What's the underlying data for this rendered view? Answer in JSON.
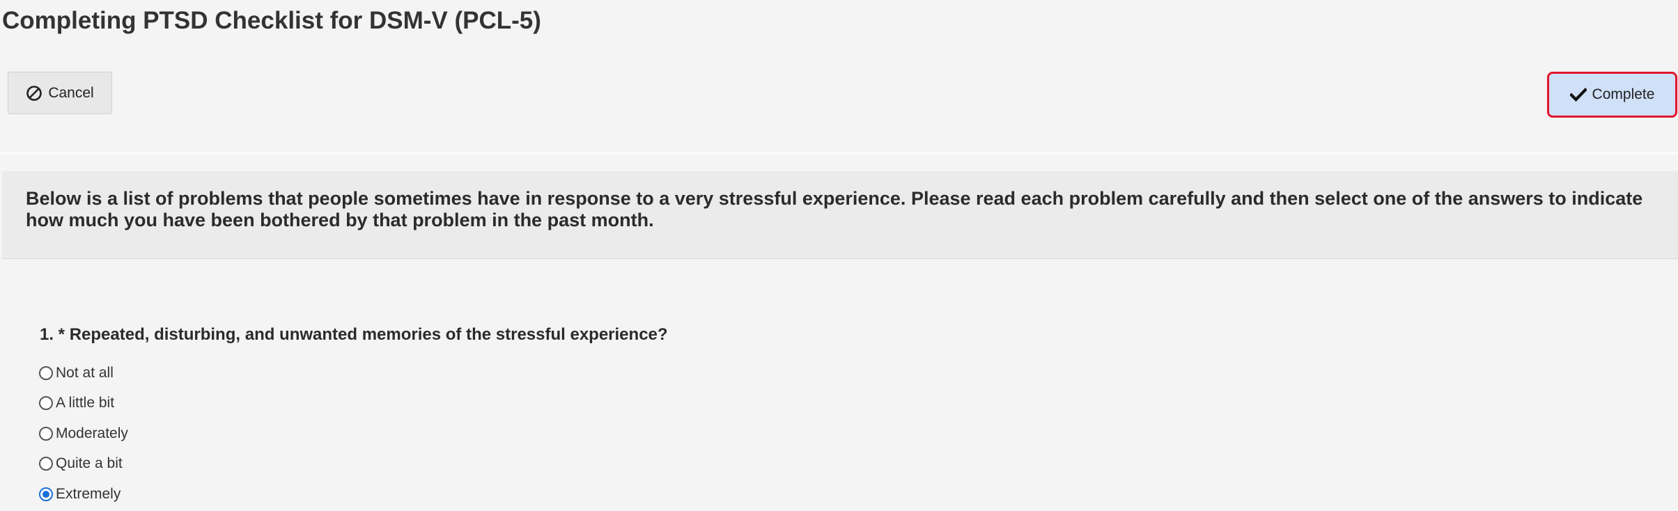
{
  "page": {
    "title": "Completing PTSD Checklist for DSM-V (PCL-5)"
  },
  "toolbar": {
    "cancel_label": "Cancel",
    "cancel_icon": "ban-icon",
    "complete_label": "Complete",
    "complete_icon": "checkmark-icon"
  },
  "instructions": {
    "text": "Below is a list of problems that people sometimes have in response to a very stressful experience. Please read each problem carefully and then select one of the answers to indicate how much you have been bothered by that problem in the past month."
  },
  "question_1": {
    "text": "1. * Repeated, disturbing, and unwanted memories of the stressful experience?",
    "options": [
      {
        "label": "Not at all",
        "selected": false
      },
      {
        "label": "A little bit",
        "selected": false
      },
      {
        "label": "Moderately",
        "selected": false
      },
      {
        "label": "Quite a bit",
        "selected": false
      },
      {
        "label": "Extremely",
        "selected": true
      }
    ]
  },
  "colors": {
    "background": "#f4f4f4",
    "instructions_bg": "#ebebeb",
    "complete_bg": "#cfe0f7",
    "complete_border": "#e0162b",
    "radio_selected": "#1a6fd9"
  }
}
